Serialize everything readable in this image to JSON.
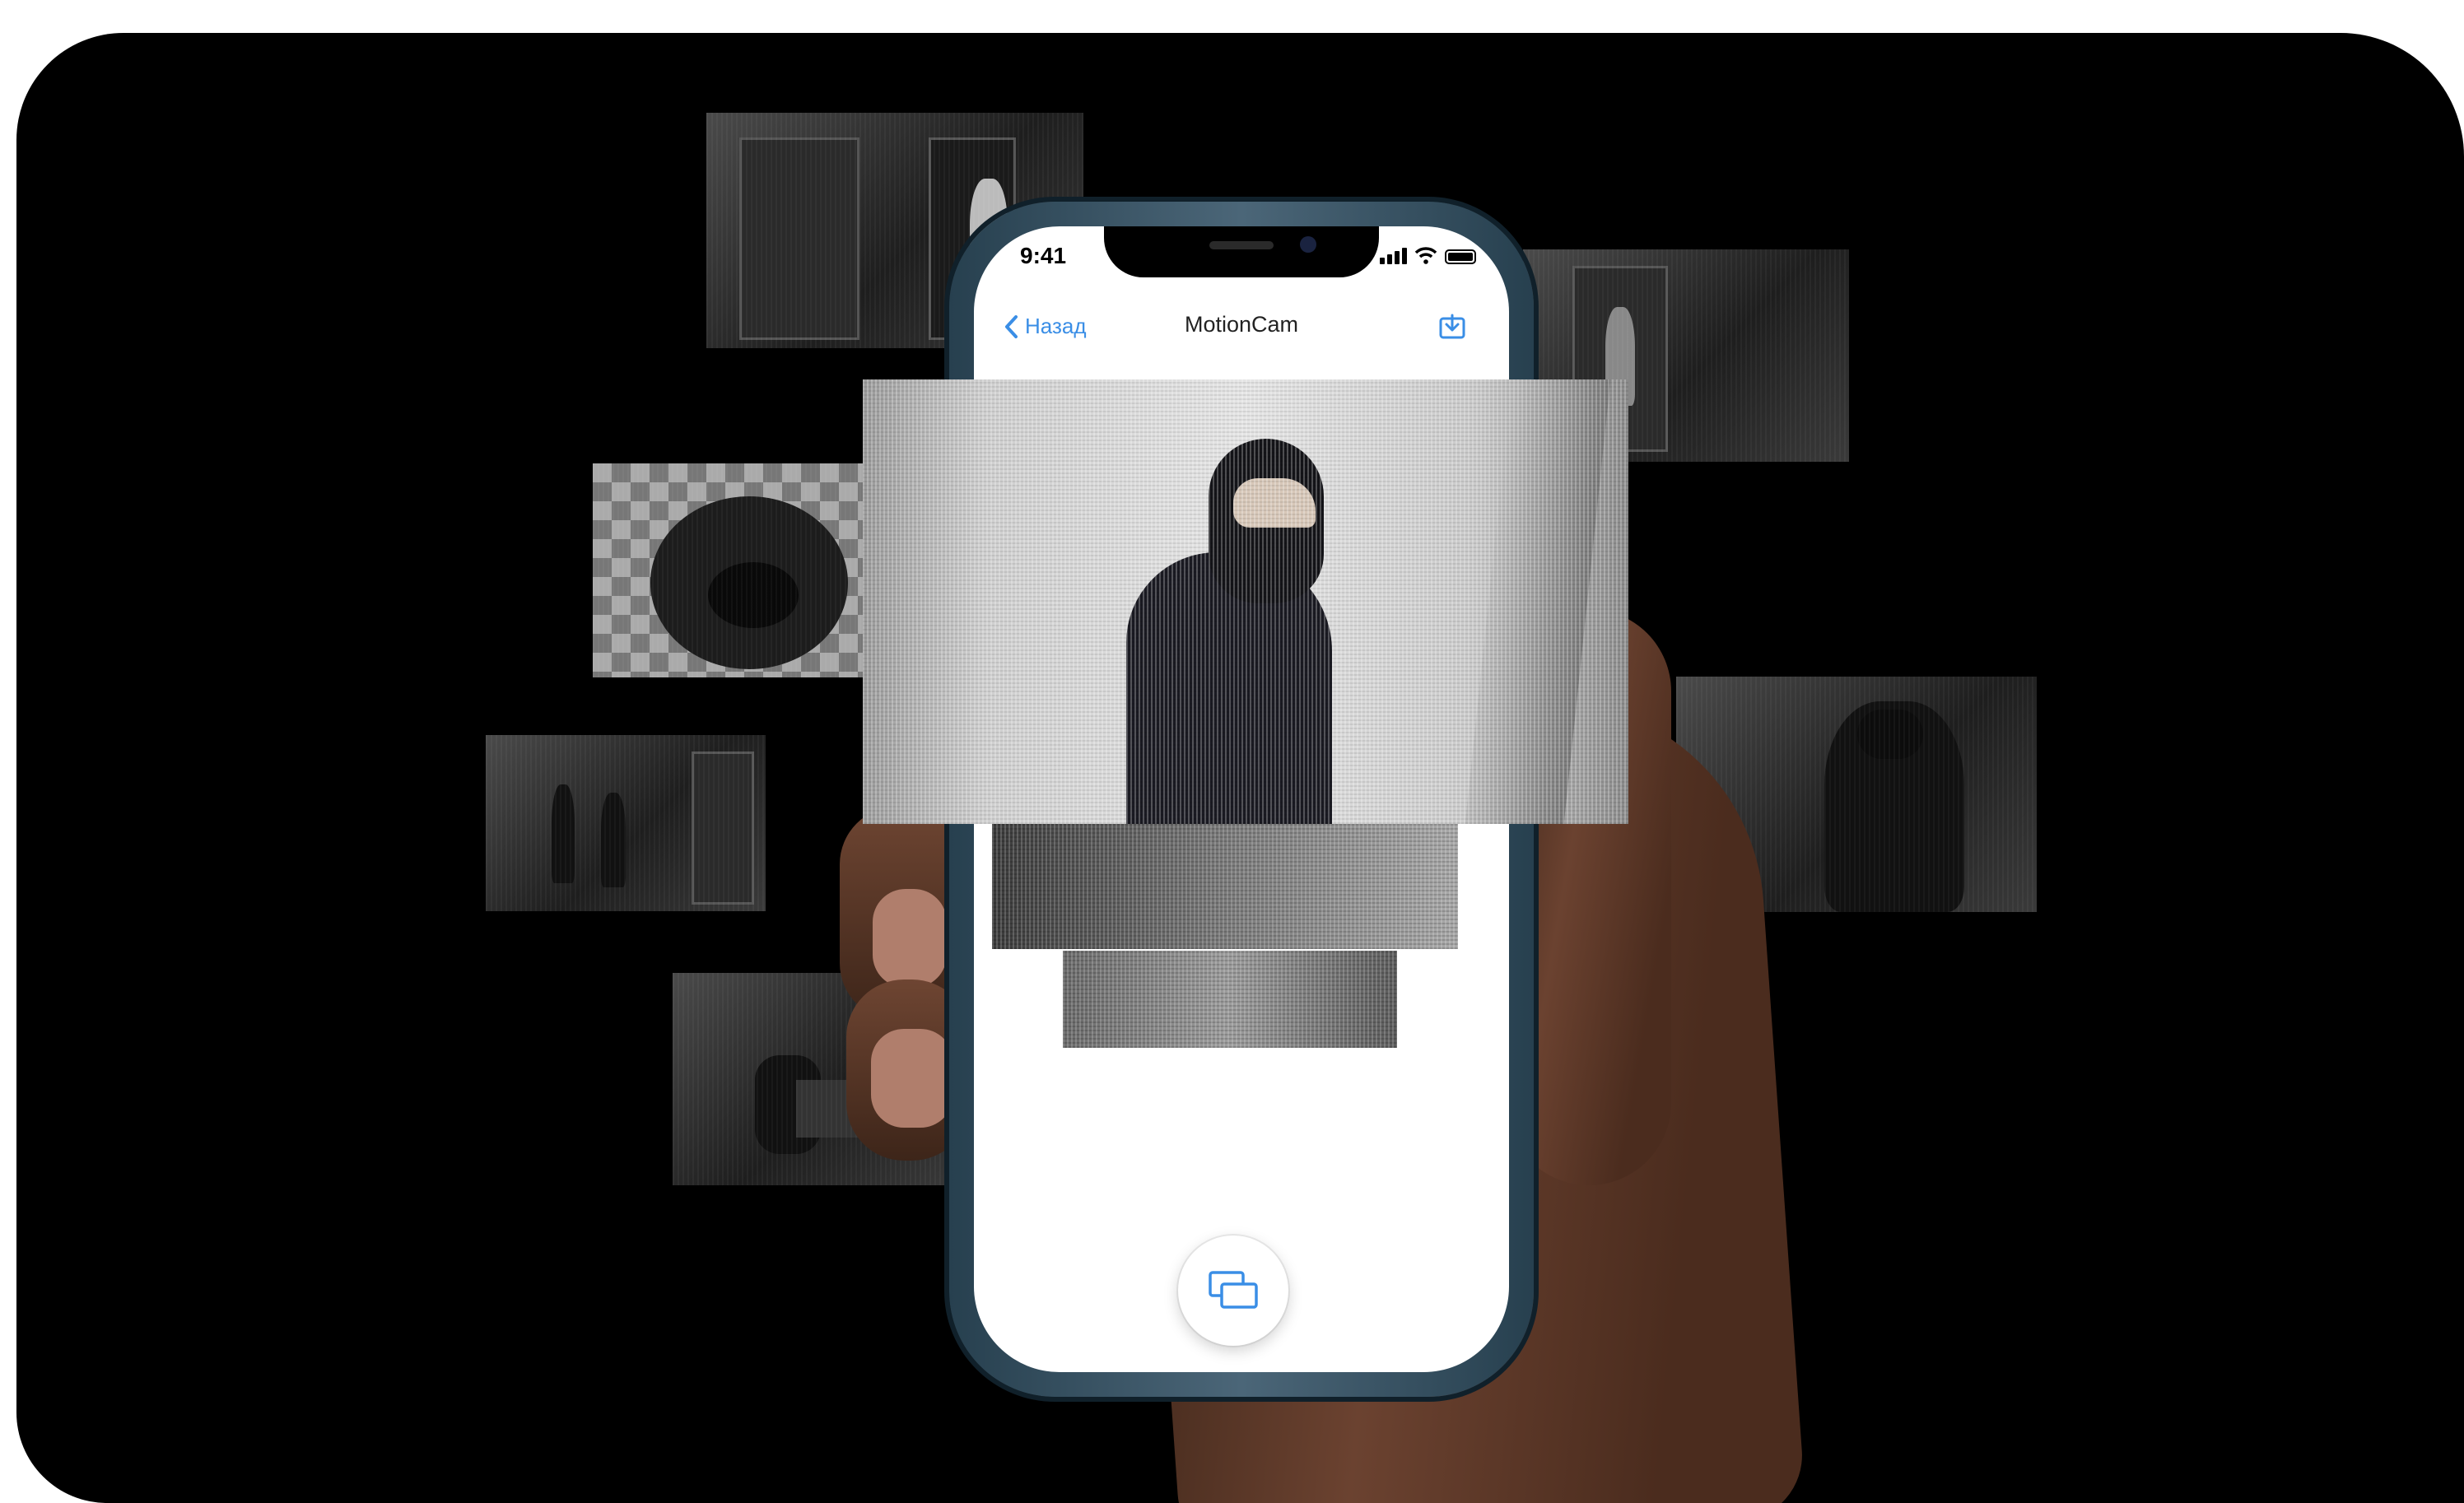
{
  "status_bar": {
    "time": "9:41"
  },
  "nav": {
    "back_label": "Назад",
    "title": "MotionCam"
  },
  "icons": {
    "back": "chevron-left-icon",
    "download": "download-icon",
    "gallery": "photo-stack-icon"
  },
  "colors": {
    "accent": "#3a8ee6",
    "background": "#000000",
    "screen": "#ffffff"
  }
}
